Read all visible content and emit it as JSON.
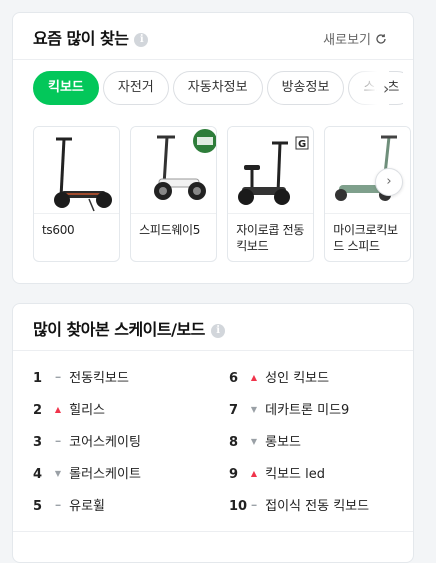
{
  "trending": {
    "title": "요즘 많이 찾는",
    "info_icon": "i",
    "refresh_label": "새로보기",
    "tabs": [
      {
        "label": "킥보드",
        "active": true
      },
      {
        "label": "자전거",
        "active": false
      },
      {
        "label": "자동차정보",
        "active": false
      },
      {
        "label": "방송정보",
        "active": false
      },
      {
        "label": "스포츠",
        "active": false
      }
    ],
    "tab_next_icon": "›",
    "products": [
      {
        "name": "ts600",
        "icon": "dark-scooter-image"
      },
      {
        "name": "스피드웨이5",
        "icon": "white-scooter-image"
      },
      {
        "name": "자이로콥 전동킥보드",
        "icon": "seated-scooter-image"
      },
      {
        "name": "마이크로킥보드 스피드",
        "icon": "green-kickboard-image"
      }
    ],
    "product_next_icon": "›"
  },
  "popular": {
    "title": "많이 찾아본 스케이트/보드",
    "info_icon": "i",
    "items": [
      {
        "rank": "1",
        "trend": "same",
        "label": "전동킥보드"
      },
      {
        "rank": "2",
        "trend": "up",
        "label": "힐리스"
      },
      {
        "rank": "3",
        "trend": "same",
        "label": "코어스케이팅"
      },
      {
        "rank": "4",
        "trend": "down",
        "label": "롤러스케이트"
      },
      {
        "rank": "5",
        "trend": "same",
        "label": "유로휠"
      },
      {
        "rank": "6",
        "trend": "up",
        "label": "성인 킥보드"
      },
      {
        "rank": "7",
        "trend": "down",
        "label": "데카트론 미드9"
      },
      {
        "rank": "8",
        "trend": "down",
        "label": "롱보드"
      },
      {
        "rank": "9",
        "trend": "up",
        "label": "킥보드 led"
      },
      {
        "rank": "10",
        "trend": "same",
        "label": "접이식 전동 킥보드"
      }
    ]
  },
  "colors": {
    "accent": "#03c75a",
    "up": "#f0344b",
    "neutral": "#9aa0a6"
  }
}
